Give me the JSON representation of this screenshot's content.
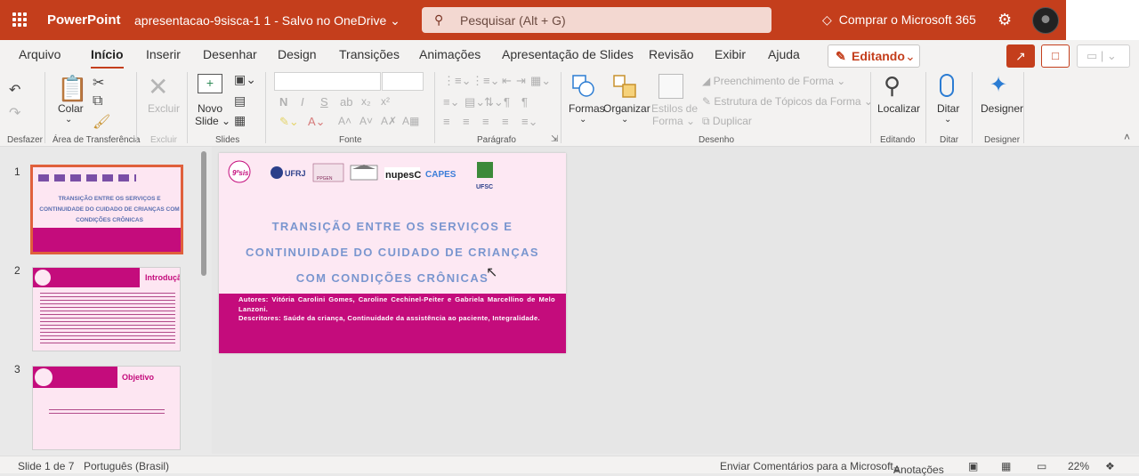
{
  "titlebar": {
    "app_name": "PowerPoint",
    "doc_title": "apresentacao-9sisca-1 1  -  Salvo no OneDrive ⌄",
    "search_placeholder": "Pesquisar (Alt + G)",
    "buy_label": "Comprar o Microsoft 365",
    "colors": {
      "brand": "#c43e1c"
    }
  },
  "tabs": {
    "items": [
      "Arquivo",
      "Início",
      "Inserir",
      "Desenhar",
      "Design",
      "Transições",
      "Animações",
      "Apresentação de Slides",
      "Revisão",
      "Exibir",
      "Ajuda"
    ],
    "active": "Início",
    "editing_label": "Editando"
  },
  "ribbon": {
    "groups": {
      "undo": "Desfazer",
      "clipboard": "Área de Transferência",
      "delete": "Excluir",
      "slides": "Slides",
      "font": "Fonte",
      "paragraph": "Parágrafo",
      "drawing": "Desenho",
      "editing": "Editando",
      "dictate": "Ditar",
      "designer": "Designer"
    },
    "buttons": {
      "paste": "Colar",
      "delete": "Excluir",
      "new_slide": "Novo",
      "new_slide_2": "Slide ⌄",
      "shapes": "Formas",
      "arrange": "Organizar",
      "styles_1": "Estilos de",
      "styles_2": "Forma ⌄",
      "fill": "Preenchimento de Forma ⌄",
      "outline": "Estrutura de Tópicos da Forma ⌄",
      "duplicate": "Duplicar",
      "find": "Localizar",
      "dictate": "Ditar",
      "designer": "Designer"
    }
  },
  "thumbnails": [
    {
      "number": "1",
      "heading": "TRANSIÇÃO ENTRE OS SERVIÇOS E CONTINUIDADE DO CUIDADO DE CRIANÇAS COM CONDIÇÕES CRÔNICAS"
    },
    {
      "number": "2",
      "heading": "Introdução"
    },
    {
      "number": "3",
      "heading": "Objetivo"
    }
  ],
  "slide": {
    "logos": [
      "UFRJ",
      "PPGEN",
      "nupesC",
      "CAPES",
      "UFSC"
    ],
    "title_lines": [
      "TRANSIÇÃO ENTRE OS SERVIÇOS E",
      "CONTINUIDADE DO CUIDADO DE CRIANÇAS",
      "COM CONDIÇÕES CRÔNICAS"
    ],
    "authors": "Autores: Vitória Carolini Gomes, Caroline Cechinel-Peiter e Gabriela Marcellino de Melo Lanzoni.",
    "descriptors": "Descritores: Saúde da criança, Continuidade da assistência ao paciente, Integralidade."
  },
  "status": {
    "slide_of": "Slide 1 de 7",
    "language": "Português (Brasil)",
    "feedback": "Enviar Comentários para a Microsoft",
    "notes": "Anotações",
    "zoom": "22%"
  }
}
